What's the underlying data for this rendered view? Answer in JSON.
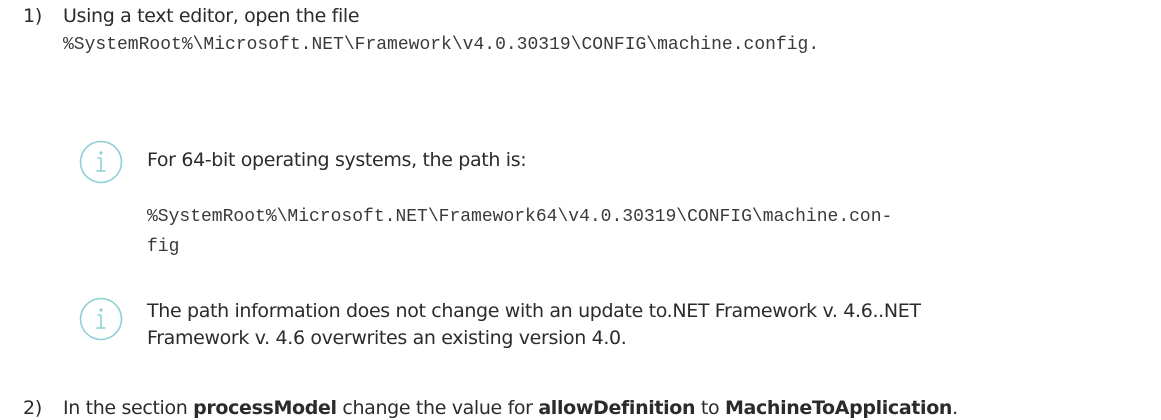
{
  "steps": [
    {
      "number": "1)",
      "text": "Using a text editor, open the file",
      "path": "%SystemRoot%\\Microsoft.NET\\Framework\\v4.0.30319\\CONFIG\\machine.config."
    },
    {
      "number": "2)",
      "text_parts": [
        "In the section ",
        "processModel",
        " change the value for ",
        "allowDefinition",
        " to ",
        "MachineToApplication",
        "."
      ]
    }
  ],
  "notes": [
    {
      "icon": "info-icon",
      "text": "For 64-bit operating systems, the path is:",
      "path_line1": "%SystemRoot%\\Microsoft.NET\\Framework64\\v4.0.30319\\CONFIG\\machine.con-",
      "path_line2": "fig"
    },
    {
      "icon": "info-icon",
      "line1": "The path information does not change with an update to.NET Framework v. 4.6..NET",
      "line2": "Framework v. 4.6 overwrites an existing version 4.0."
    }
  ],
  "colors": {
    "icon": "#8fd0d6",
    "text": "#2b2b2b"
  }
}
